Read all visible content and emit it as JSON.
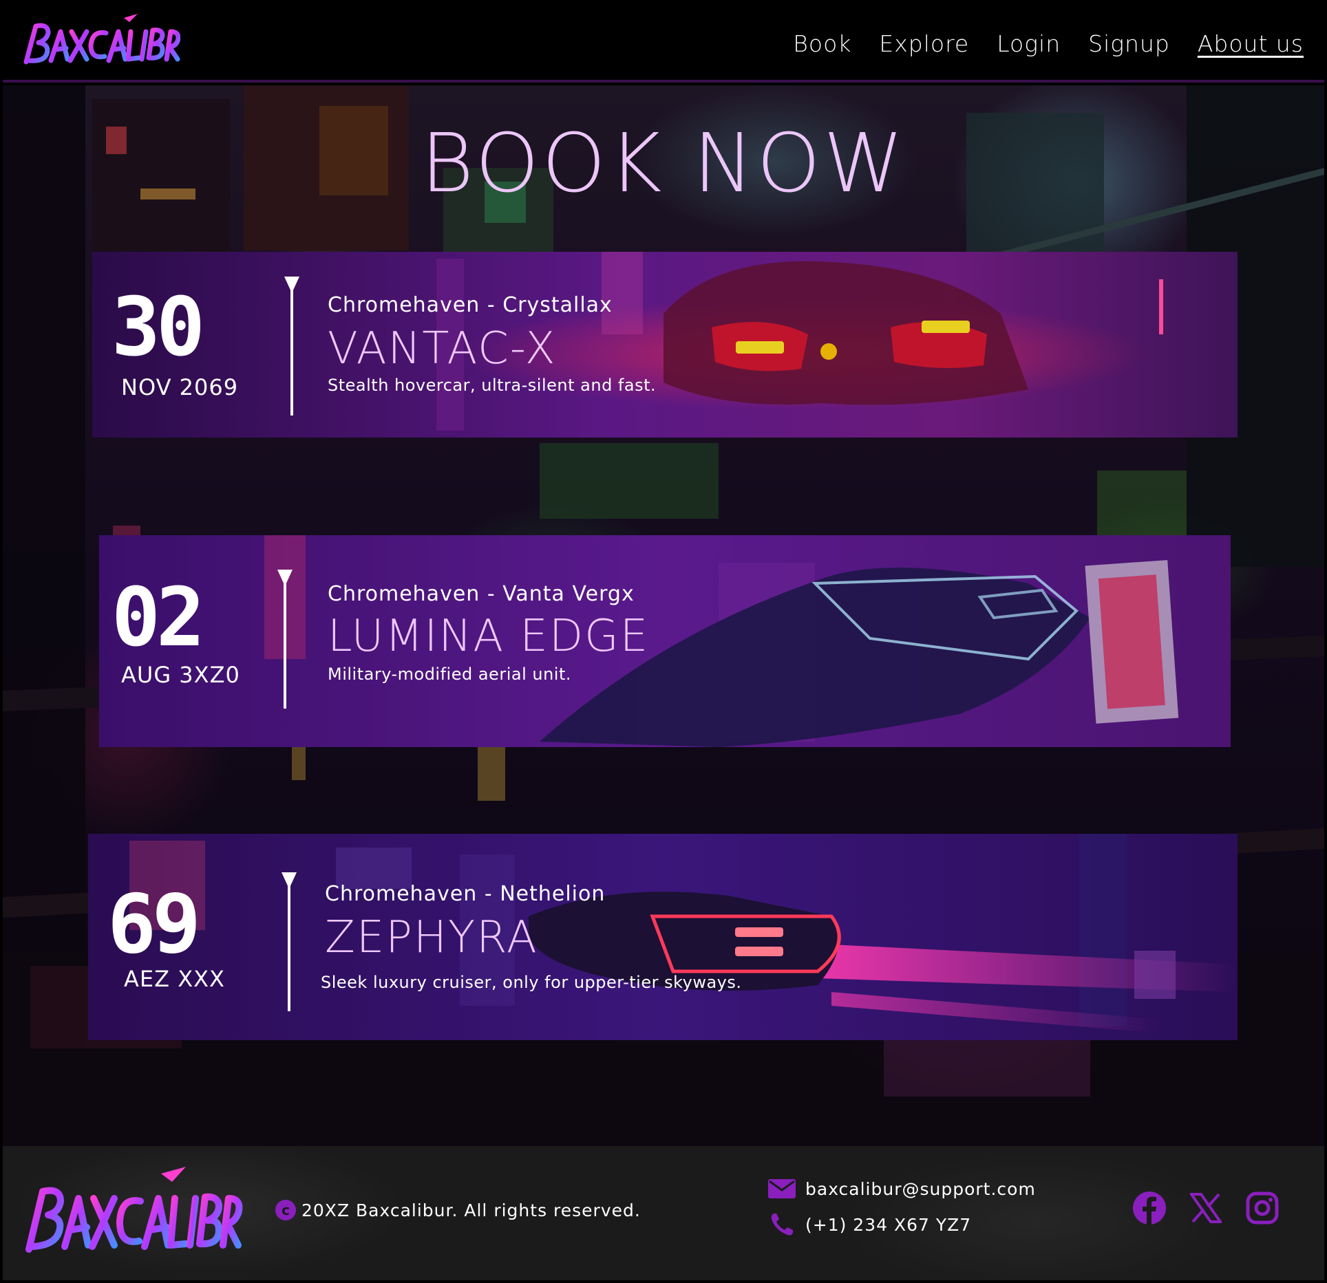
{
  "brand": {
    "name": "BAXCALIBUR",
    "accent": "#8a1fbe",
    "title_color": "#ecc6f8"
  },
  "nav": {
    "items": [
      {
        "label": "Book"
      },
      {
        "label": "Explore"
      },
      {
        "label": "Login"
      },
      {
        "label": "Signup"
      },
      {
        "label": "About us",
        "active": true
      }
    ]
  },
  "hero": {
    "title": "BOOK NOW"
  },
  "bookings": [
    {
      "day": "30",
      "month_year": "NOV 2069",
      "route": "Chromehaven - Crystallax",
      "model": "VANTAC-X",
      "description": "Stealth hovercar, ultra-silent and fast."
    },
    {
      "day": "02",
      "month_year": "AUG 3XZ0",
      "route": "Chromehaven - Vanta Vergx",
      "model": "LUMINA EDGE",
      "description": "Military-modified aerial unit."
    },
    {
      "day": "69",
      "month_year": "AEZ XXX",
      "route": "Chromehaven - Nethelion",
      "model": "ZEPHYRA",
      "description": "Sleek luxury cruiser, only for upper-tier skyways."
    }
  ],
  "footer": {
    "copyright_symbol": "c",
    "copyright": "20XZ Baxcalibur. All rights reserved.",
    "email": "baxcalibur@support.com",
    "phone": "(+1) 234 X67 YZ7",
    "icons": [
      "mail-icon",
      "phone-icon",
      "facebook-icon",
      "x-icon",
      "instagram-icon"
    ]
  }
}
